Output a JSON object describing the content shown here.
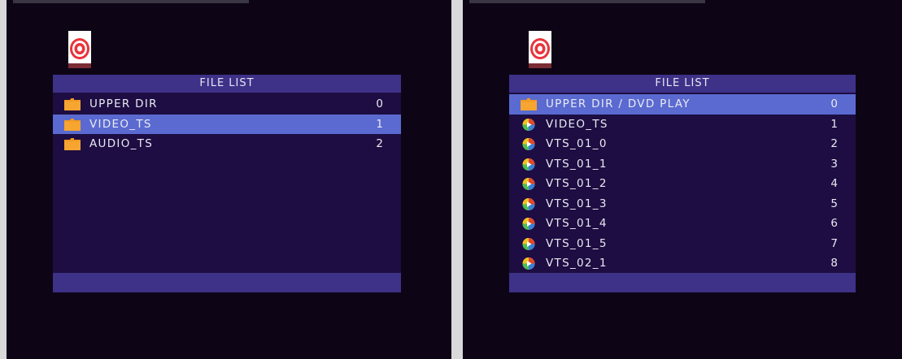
{
  "left": {
    "header": "FILE LIST",
    "selected_index": 1,
    "items": [
      {
        "name": "UPPER DIR",
        "index": "0",
        "icon": "folder-icon"
      },
      {
        "name": "VIDEO_TS",
        "index": "1",
        "icon": "folder-icon"
      },
      {
        "name": "AUDIO_TS",
        "index": "2",
        "icon": "folder-icon"
      }
    ]
  },
  "right": {
    "header": "FILE LIST",
    "selected_index": 0,
    "items": [
      {
        "name": "UPPER DIR / DVD PLAY",
        "index": "0",
        "icon": "folder-icon"
      },
      {
        "name": "VIDEO_TS",
        "index": "1",
        "icon": "disc-file-icon"
      },
      {
        "name": "VTS_01_0",
        "index": "2",
        "icon": "disc-file-icon"
      },
      {
        "name": "VTS_01_1",
        "index": "3",
        "icon": "disc-file-icon"
      },
      {
        "name": "VTS_01_2",
        "index": "4",
        "icon": "disc-file-icon"
      },
      {
        "name": "VTS_01_3",
        "index": "5",
        "icon": "disc-file-icon"
      },
      {
        "name": "VTS_01_4",
        "index": "6",
        "icon": "disc-file-icon"
      },
      {
        "name": "VTS_01_5",
        "index": "7",
        "icon": "disc-file-icon"
      },
      {
        "name": "VTS_02_1",
        "index": "8",
        "icon": "disc-file-icon"
      }
    ]
  },
  "colors": {
    "screen_bg": "#0d0516",
    "panel_bg": "#1d0d42",
    "header_bg": "#3e3188",
    "selected_bg": "#5a6ad0",
    "folder": "#f29a22"
  }
}
